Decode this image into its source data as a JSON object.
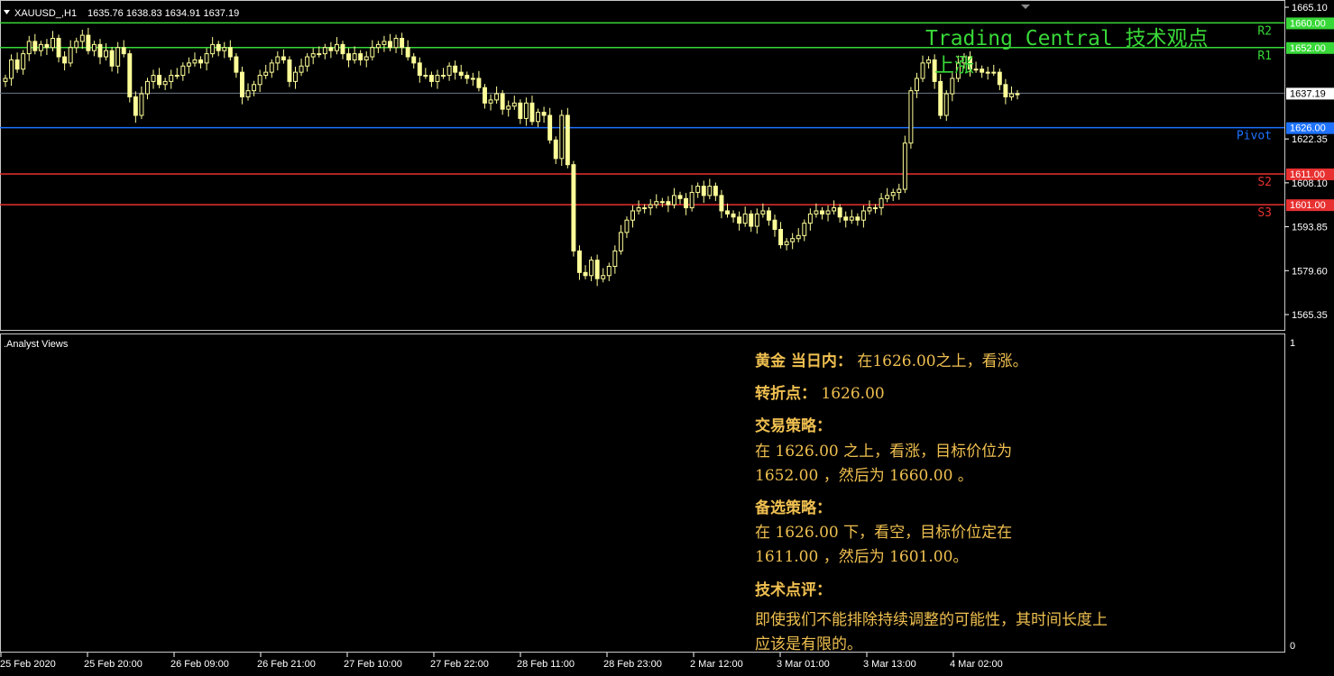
{
  "header": {
    "symbol": "XAUUSD_,H1",
    "ohlc": "1635.76 1638.83 1634.91 1637.19"
  },
  "overlay": {
    "title": "Trading Central 技术观点",
    "direction": "上涨"
  },
  "levels": [
    {
      "id": "R2",
      "label": "R2",
      "price": 1660.0,
      "tag": "1660.00",
      "color": "#38d838"
    },
    {
      "id": "R1",
      "label": "R1",
      "price": 1652.0,
      "tag": "1652.00",
      "color": "#38d838"
    },
    {
      "id": "pivot",
      "label": "Pivot",
      "price": 1626.0,
      "tag": "1626.00",
      "color": "#1e72ff"
    },
    {
      "id": "S2",
      "label": "S2",
      "price": 1611.0,
      "tag": "1611.00",
      "color": "#e83030"
    },
    {
      "id": "S3",
      "label": "S3",
      "price": 1601.0,
      "tag": "1601.00",
      "color": "#e83030"
    }
  ],
  "current_price": {
    "price": 1637.19,
    "tag": "1637.19"
  },
  "price_axis": [
    "1665.10",
    "1622.35",
    "1608.10",
    "1593.85",
    "1579.60",
    "1565.35"
  ],
  "time_axis": [
    "25 Feb 2020",
    "25 Feb 20:00",
    "26 Feb 09:00",
    "26 Feb 21:00",
    "27 Feb 10:00",
    "27 Feb 22:00",
    "28 Feb 11:00",
    "28 Feb 23:00",
    "2 Mar 12:00",
    "3 Mar 01:00",
    "3 Mar 13:00",
    "4 Mar 02:00"
  ],
  "indicator": {
    "name": ".Analyst Views",
    "scale_top": "1",
    "scale_bottom": "0"
  },
  "analyst": {
    "line1_bold": "黄金 当日内：",
    "line1_text": " 在1626.00之上，看涨。",
    "pivot_bold": "转折点：",
    "pivot_text": " 1626.00",
    "strategy_title": "交易策略：",
    "strategy_text1": "在 1626.00 之上，看涨，目标价位为",
    "strategy_text2": "1652.00 ，然后为 1660.00 。",
    "alt_title": "备选策略：",
    "alt_text1": "在 1626.00 下，看空，目标价位定在",
    "alt_text2": "1611.00 ，然后为 1601.00。",
    "comment_title": "技术点评：",
    "comment_text1": "即使我们不能排除持续调整的可能性，其时间长度上",
    "comment_text2": "应该是有限的。"
  },
  "colors": {
    "candle": "#ffff99",
    "axis": "#ffffff",
    "analyst_text": "#f0c050",
    "overlay_text": "#38d838"
  },
  "chart_data": {
    "type": "candlestick",
    "timeframe": "H1",
    "ylim": [
      1561.0,
      1667.0
    ],
    "closes": [
      1642,
      1648,
      1645,
      1650,
      1654,
      1651,
      1653,
      1652,
      1655,
      1649,
      1647,
      1652,
      1654,
      1656,
      1651,
      1653,
      1649,
      1651,
      1646,
      1652,
      1650,
      1636,
      1630,
      1637,
      1641,
      1643,
      1640,
      1641,
      1643,
      1643,
      1646,
      1647,
      1648,
      1647,
      1650,
      1653,
      1651,
      1652,
      1649,
      1644,
      1636,
      1638,
      1640,
      1643,
      1644,
      1647,
      1649,
      1648,
      1641,
      1644,
      1646,
      1649,
      1650,
      1650,
      1652,
      1651,
      1653,
      1650,
      1648,
      1650,
      1648,
      1649,
      1652,
      1653,
      1654,
      1652,
      1655,
      1652,
      1649,
      1647,
      1643,
      1643,
      1641,
      1643,
      1643,
      1646,
      1644,
      1643,
      1642,
      1642,
      1639,
      1634,
      1635,
      1637,
      1632,
      1633,
      1634,
      1629,
      1634,
      1628,
      1631,
      1630,
      1622,
      1616,
      1630,
      1614,
      1586,
      1579,
      1578,
      1583,
      1577,
      1578,
      1581,
      1586,
      1592,
      1596,
      1599,
      1600,
      1600,
      1601,
      1602,
      1602,
      1601,
      1604,
      1603,
      1600,
      1605,
      1607,
      1604,
      1607,
      1604,
      1599,
      1598,
      1597,
      1595,
      1598,
      1594,
      1598,
      1599,
      1596,
      1593,
      1588,
      1589,
      1590,
      1591,
      1595,
      1598,
      1599,
      1598,
      1599,
      1600,
      1597,
      1596,
      1597,
      1596,
      1599,
      1600,
      1600,
      1603,
      1604,
      1605,
      1606,
      1621,
      1638,
      1642,
      1647,
      1648,
      1641,
      1630,
      1637,
      1642,
      1647,
      1649,
      1645,
      1645,
      1644,
      1644,
      1644,
      1640,
      1636,
      1637,
      1637
    ]
  }
}
